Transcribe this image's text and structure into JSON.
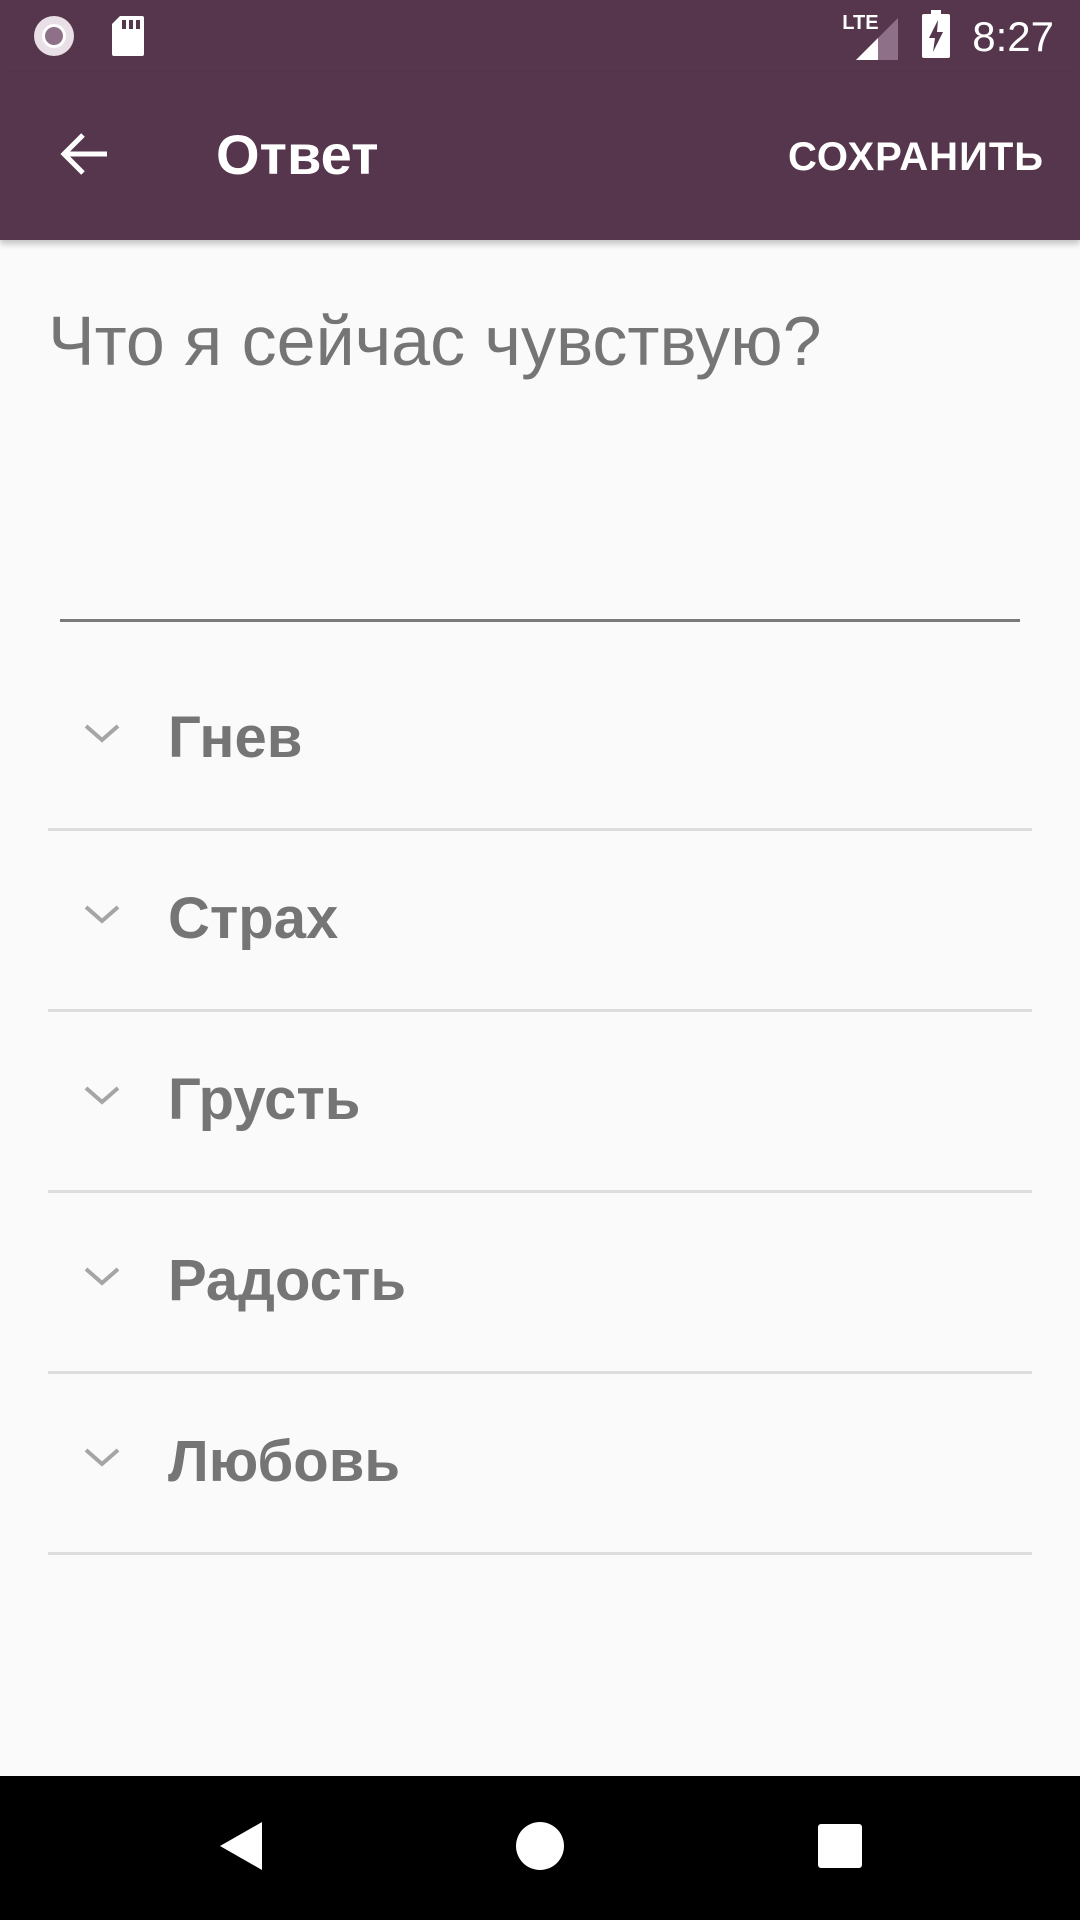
{
  "status_bar": {
    "time": "8:27",
    "network_label": "LTE",
    "icons": [
      "record-icon",
      "sd-card-icon",
      "lte-signal-icon",
      "battery-charging-icon"
    ]
  },
  "app_bar": {
    "title": "Ответ",
    "save_label": "СОХРАНИТЬ",
    "back_icon": "arrow-back-icon"
  },
  "answer": {
    "placeholder": "Что я сейчас чувствую?",
    "value": ""
  },
  "emotions": {
    "items": [
      {
        "label": "Гнев"
      },
      {
        "label": "Страх"
      },
      {
        "label": "Грусть"
      },
      {
        "label": "Радость"
      },
      {
        "label": "Любовь"
      }
    ]
  },
  "nav_bar": {
    "icons": [
      "nav-back-icon",
      "nav-home-icon",
      "nav-recents-icon"
    ]
  },
  "colors": {
    "primary": "#56364d",
    "background": "#fafafa",
    "text_secondary": "#757575",
    "divider": "#dddddd"
  }
}
